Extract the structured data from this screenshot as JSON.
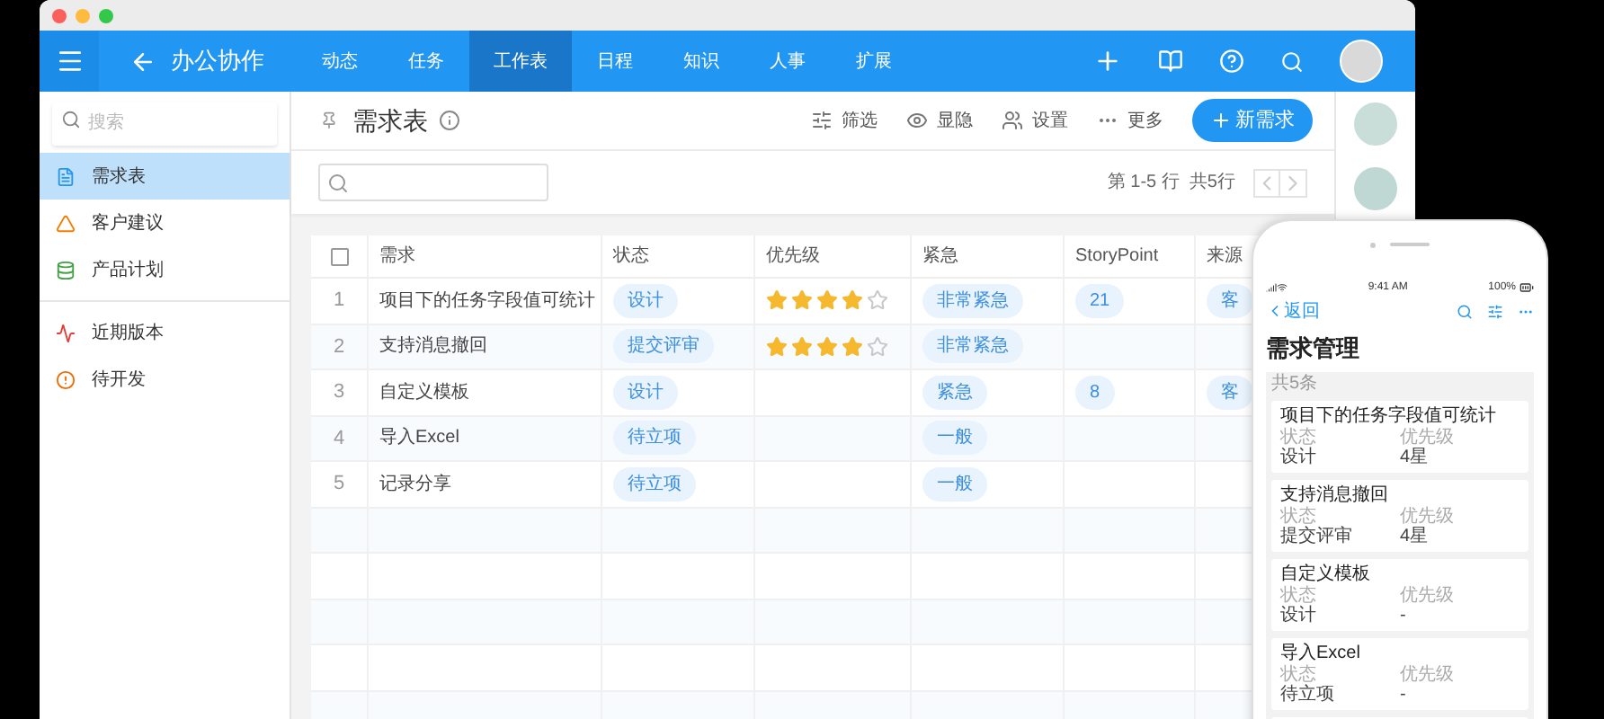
{
  "nav": {
    "app_title": "办公协作",
    "tabs": [
      {
        "label": "动态",
        "selected": false
      },
      {
        "label": "任务",
        "selected": false
      },
      {
        "label": "工作表",
        "selected": true
      },
      {
        "label": "日程",
        "selected": false
      },
      {
        "label": "知识",
        "selected": false
      },
      {
        "label": "人事",
        "selected": false
      },
      {
        "label": "扩展",
        "selected": false
      }
    ]
  },
  "sidebar": {
    "search": {
      "placeholder": "搜索"
    },
    "groups": [
      [
        {
          "label": "需求表",
          "selected": true
        },
        {
          "label": "客户建议",
          "selected": false
        },
        {
          "label": "产品计划",
          "selected": false
        }
      ],
      [
        {
          "label": "近期版本",
          "selected": false
        },
        {
          "label": "待开发",
          "selected": false
        }
      ]
    ]
  },
  "toolbar": {
    "title": "需求表",
    "actions": [
      "筛选",
      "显隐",
      "设置",
      "更多"
    ],
    "new_button": "新需求",
    "pager": "第 1-5 行  共5行"
  },
  "table": {
    "select_all_checked": false,
    "columns": [
      "需求",
      "状态",
      "优先级",
      "紧急",
      "StoryPoint",
      "来源"
    ],
    "rows": [
      {
        "number": "1",
        "title": "项目下的任务字段值可统计",
        "status": "设计",
        "stars": 4,
        "urgency": "非常紧急",
        "story_point": "21",
        "source": "客"
      },
      {
        "number": "2",
        "title": "支持消息撤回",
        "status": "提交评审",
        "stars": 4,
        "urgency": "非常紧急"
      },
      {
        "number": "3",
        "title": "自定义模板",
        "status": "设计",
        "urgency": "紧急",
        "story_point": "8",
        "source": "客"
      },
      {
        "number": "4",
        "title": "导入Excel",
        "status": "待立项",
        "urgency": "一般"
      },
      {
        "number": "5",
        "title": "记录分享",
        "status": "待立项",
        "urgency": "一般"
      }
    ]
  },
  "phone": {
    "time": "9:41 AM",
    "battery": "100%",
    "back": "返回",
    "title": "需求管理",
    "count": "共5条",
    "cards": [
      {
        "title": "项目下的任务字段值可统计",
        "fields": [
          {
            "label": "状态",
            "value": "设计"
          },
          {
            "label": "优先级",
            "value": "4星"
          }
        ]
      },
      {
        "title": "支持消息撤回",
        "fields": [
          {
            "label": "状态",
            "value": "提交评审"
          },
          {
            "label": "优先级",
            "value": "4星"
          }
        ]
      },
      {
        "title": "自定义模板",
        "fields": [
          {
            "label": "状态",
            "value": "设计"
          },
          {
            "label": "优先级",
            "value": "-"
          }
        ]
      },
      {
        "title": "导入Excel",
        "fields": [
          {
            "label": "状态",
            "value": "待立项"
          },
          {
            "label": "优先级",
            "value": "-"
          }
        ]
      }
    ]
  }
}
